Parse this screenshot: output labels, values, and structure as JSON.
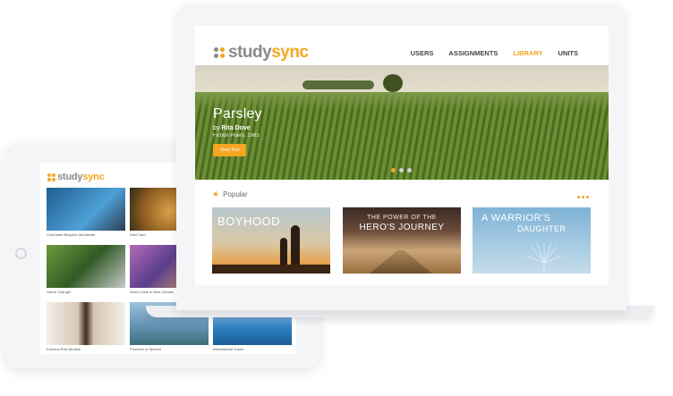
{
  "brand": {
    "study": "study",
    "sync": "sync",
    "dot_colors": [
      "#8a8a8a",
      "#f5a623",
      "#8a8a8a",
      "#f5a623"
    ]
  },
  "nav": {
    "items": [
      "USERS",
      "ASSIGNMENTS",
      "LIBRARY",
      "UNITS"
    ],
    "active": "LIBRARY"
  },
  "hero": {
    "title": "Parsley",
    "by_prefix": "by",
    "author": "Rita Dove",
    "meta": "Fiction Poem, 1983",
    "button": "View Text"
  },
  "popular": {
    "label": "Popular",
    "cards": [
      {
        "title": "BOYHOOD"
      },
      {
        "title_line1": "THE POWER OF THE",
        "title_line2": "HERO'S JOURNEY"
      },
      {
        "title_line1": "A WARRIOR'S",
        "title_line2": "DAUGHTER"
      }
    ]
  },
  "tablet": {
    "brand_study": "study",
    "brand_sync": "sync",
    "cards": [
      {
        "caption": "Commuter Bicycles Worldwide",
        "color": "#3b7fb8"
      },
      {
        "caption": "Wild Card",
        "color": "#c8892f"
      },
      {
        "caption": "Game Changer",
        "color": "#5c8f3a"
      },
      {
        "caption": "Word Crisis in New Orleans",
        "color": "#8d6aa8"
      },
      {
        "caption": "Famous Role Models",
        "color": "#c9a27b"
      },
      {
        "caption": "Freedom of Speech",
        "color": "#6c9ab8"
      },
      {
        "caption": "International Travel",
        "color": "#2f7fc0"
      }
    ]
  },
  "colors": {
    "accent": "#f5a623",
    "text": "#444444"
  }
}
